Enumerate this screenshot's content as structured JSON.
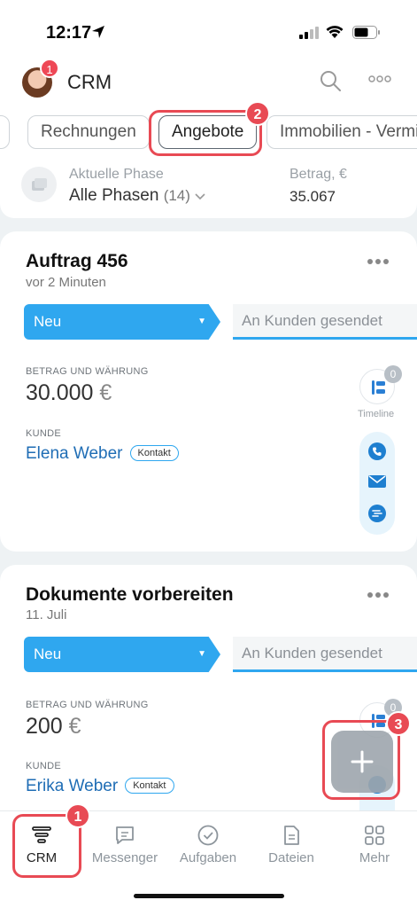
{
  "status_bar": {
    "time": "12:17"
  },
  "header": {
    "title": "CRM",
    "avatar_badge": "1"
  },
  "tabs": [
    {
      "label": "n"
    },
    {
      "label": "Rechnungen"
    },
    {
      "label": "Angebote",
      "active": true
    },
    {
      "label": "Immobilien - Vermie"
    }
  ],
  "phase_summary": {
    "phase_label": "Aktuelle Phase",
    "phase_value": "Alle Phasen",
    "phase_count": "(14)",
    "amount_label": "Betrag, €",
    "amount_value": "35.067"
  },
  "cards": [
    {
      "title": "Auftrag 456",
      "subtitle": "vor 2 Minuten",
      "stage_current": "Neu",
      "stage_next": "An Kunden gesendet",
      "amount_label": "BETRAG UND WÄHRUNG",
      "amount_value": "30.000",
      "currency": "€",
      "customer_label": "KUNDE",
      "customer_name": "Elena Weber",
      "customer_type": "Kontakt",
      "timeline_count": "0",
      "timeline_label": "Timeline"
    },
    {
      "title": "Dokumente vorbereiten",
      "subtitle": "11. Juli",
      "stage_current": "Neu",
      "stage_next": "An Kunden gesendet",
      "amount_label": "BETRAG UND WÄHRUNG",
      "amount_value": "200",
      "currency": "€",
      "customer_label": "KUNDE",
      "customer_name": "Erika Weber",
      "customer_type": "Kontakt",
      "timeline_count": "0"
    }
  ],
  "annotations": {
    "step1": "1",
    "step2": "2",
    "step3": "3"
  },
  "fab": {
    "icon": "plus-icon"
  },
  "bottom_nav": [
    {
      "label": "CRM",
      "icon": "funnel-icon",
      "active": true
    },
    {
      "label": "Messenger",
      "icon": "chat-icon"
    },
    {
      "label": "Aufgaben",
      "icon": "check-circle-icon"
    },
    {
      "label": "Dateien",
      "icon": "document-icon"
    },
    {
      "label": "Mehr",
      "icon": "grid-icon"
    }
  ],
  "colors": {
    "accent": "#2fa7ef",
    "highlight": "#e84a54",
    "link": "#1f6db5"
  }
}
